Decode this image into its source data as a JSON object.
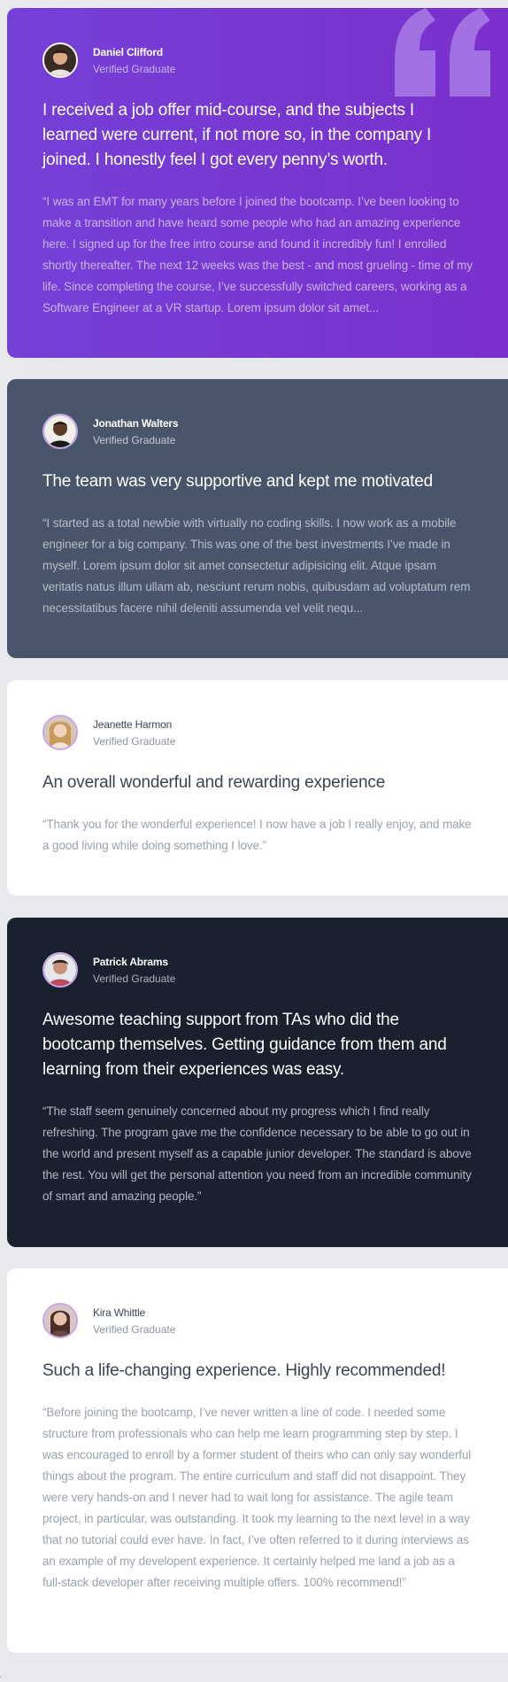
{
  "colors": {
    "page_background": "#e8e9ed",
    "purple_card": "#7440d7",
    "grey_card": "#48556a",
    "white_card": "#ffffff",
    "dark_card": "#19212e",
    "avatar_ring": "#c7a6e8"
  },
  "testimonials": [
    {
      "name": "Daniel Clifford",
      "role": "Verified Graduate",
      "avatar_icon": "user-avatar-icon",
      "headline": "I received a job offer mid-course, and the subjects I learned were current, if not more so, in the company I joined. I honestly feel I got every penny’s worth.",
      "quote": "“I was an EMT for many years before I joined the bootcamp. I’ve been looking to make a transition and have heard some people who had an amazing experience here. I signed up for the free intro course and found it incredibly fun! I enrolled shortly thereafter. The next 12 weeks was the best - and most grueling - time of my life. Since completing the course, I’ve successfully switched careers, working as a Software Engineer at a VR startup. Lorem ipsum dolor sit amet..."
    },
    {
      "name": "Jonathan Walters",
      "role": "Verified Graduate",
      "avatar_icon": "user-avatar-icon",
      "headline": "The team was very supportive and kept me motivated",
      "quote": "“I started as a total newbie with virtually no coding skills. I now work as a mobile engineer for a big company. This was one of the best investments I’ve made in myself. Lorem ipsum dolor sit amet consectetur adipisicing elit. Atque ipsam veritatis natus illum ullam ab, nesciunt rerum nobis, quibusdam ad voluptatum rem necessitatibus facere nihil deleniti assumenda vel velit nequ..."
    },
    {
      "name": "Jeanette Harmon",
      "role": "Verified Graduate",
      "avatar_icon": "user-avatar-icon",
      "headline": "An overall wonderful and rewarding experience",
      "quote": "“Thank you for the wonderful experience! I now have a job I really enjoy, and make a good living while doing something I love.”"
    },
    {
      "name": "Patrick Abrams",
      "role": "Verified Graduate",
      "avatar_icon": "user-avatar-icon",
      "headline": "Awesome teaching support from TAs who did the bootcamp themselves. Getting guidance from them and learning from their experiences was easy.",
      "quote": "“The staff seem genuinely concerned about my progress which I find really refreshing. The program gave me the confidence necessary to be able to go out in the world and present myself as a capable junior developer. The standard is above the rest. You will get the personal attention you need from an incredible community of smart and amazing people.”"
    },
    {
      "name": "Kira Whittle",
      "role": "Verified Graduate",
      "avatar_icon": "user-avatar-icon",
      "headline": "Such a life-changing experience. Highly recommended!",
      "quote": "“Before joining the bootcamp, I’ve never written a line of code. I needed some structure from professionals who can help me learn programming step by step. I was encouraged to enroll by a former student of theirs who can only say wonderful things about the program. The entire curriculum and staff did not disappoint. They were very hands-on and I never had to wait long for assistance. The agile team project, in particular, was outstanding. It took my learning to the next level in a way that no tutorial could ever have. In fact, I’ve often referred to it during interviews as an example of my developent experience. It certainly helped me land a job as a full-stack developer after receiving multiple offers. 100% recommend!”"
    }
  ],
  "decor": {
    "quote_icon": "quotation-mark-icon",
    "corner_glyph": "'"
  }
}
